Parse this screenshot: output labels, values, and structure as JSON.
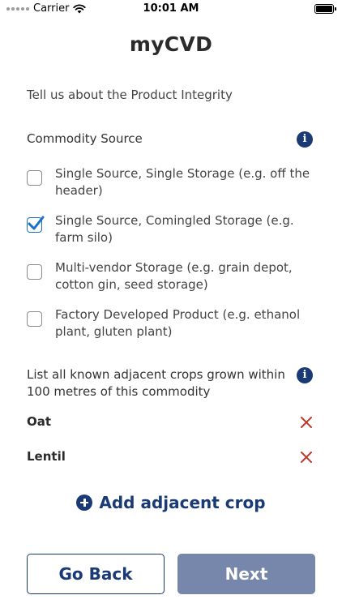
{
  "status_bar": {
    "carrier": "Carrier",
    "time": "10:01 AM"
  },
  "app": {
    "title": "myCVD"
  },
  "intro": "Tell us about the Product Integrity",
  "commodity_source": {
    "label": "Commodity Source",
    "options": [
      {
        "label": "Single Source, Single Storage (e.g. off the header)",
        "checked": false
      },
      {
        "label": "Single Source, Comingled Storage (e.g. farm silo)",
        "checked": true
      },
      {
        "label": "Multi-vendor Storage (e.g. grain depot, cotton gin, seed storage)",
        "checked": false
      },
      {
        "label": "Factory Developed Product (e.g. ethanol plant, gluten plant)",
        "checked": false
      }
    ]
  },
  "adjacent_crops": {
    "label": "List all known adjacent crops grown within 100 metres of this commodity",
    "items": [
      "Oat",
      "Lentil"
    ],
    "add_label": "Add adjacent crop"
  },
  "buttons": {
    "back": "Go Back",
    "next": "Next"
  },
  "colors": {
    "primary": "#1a3a75",
    "remove": "#c0392b",
    "check": "#1a6fc9",
    "next_bg": "#7786ab"
  }
}
